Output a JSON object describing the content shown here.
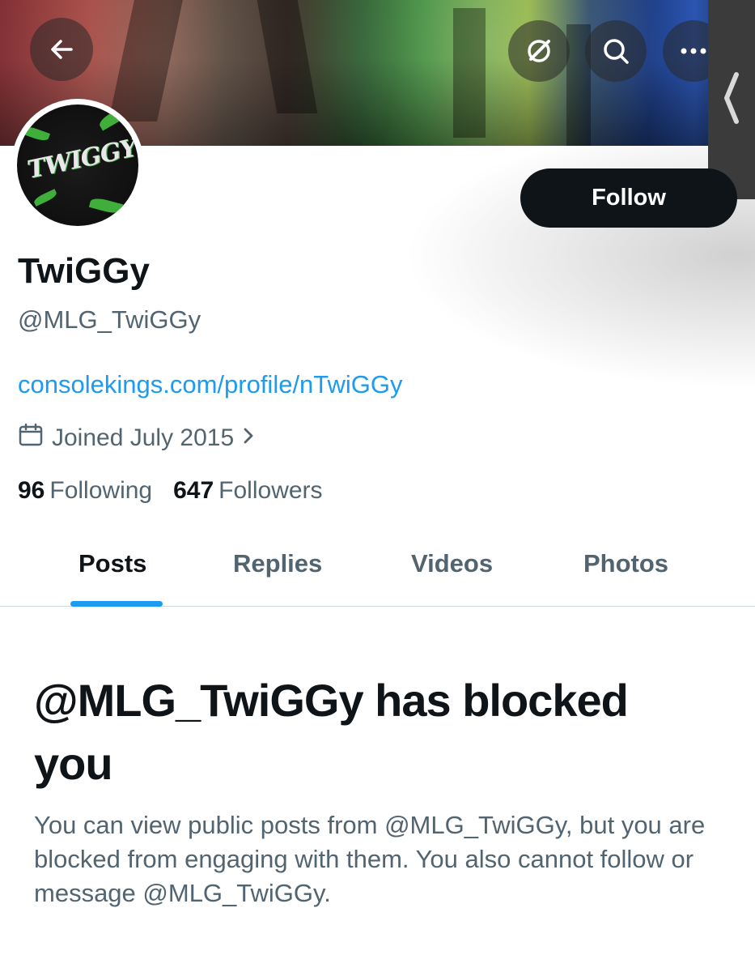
{
  "header": {
    "back_icon": "arrow-left-icon",
    "grok_icon": "slashed-circle-icon",
    "search_icon": "search-icon",
    "more_icon": "more-horizontal-icon",
    "side_tab_icon": "chevron-left-icon"
  },
  "profile": {
    "avatar_text": "TWIGGY",
    "display_name": "TwiGGy",
    "handle": "@MLG_TwiGGy",
    "website": "consolekings.com/profile/nTwiGGy",
    "joined": "Joined July 2015",
    "following_count": "96",
    "following_label": "Following",
    "followers_count": "647",
    "followers_label": "Followers",
    "follow_label": "Follow"
  },
  "tabs": [
    {
      "label": "Posts",
      "active": true
    },
    {
      "label": "Replies",
      "active": false
    },
    {
      "label": "Videos",
      "active": false
    },
    {
      "label": "Photos",
      "active": false
    }
  ],
  "blocked": {
    "title": "@MLG_TwiGGy has blocked you",
    "description": "You can view public posts from @MLG_TwiGGy, but you are blocked from engaging with them. You also cannot follow or message @MLG_TwiGGy."
  },
  "colors": {
    "accent": "#1d9bf0",
    "text": "#0f1419",
    "secondary": "#536471",
    "button_bg": "#0f1419"
  }
}
